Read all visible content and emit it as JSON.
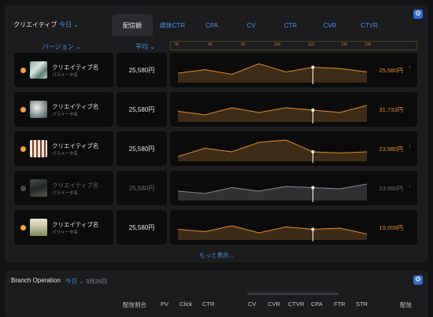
{
  "panel": {
    "title": "クリエイティブ",
    "scope": "今日 ⌄",
    "tabs": [
      "配信額",
      "媒体CTR",
      "CPA",
      "CV",
      "CTR",
      "CVR",
      "CTVR"
    ],
    "active_tab": 0,
    "version_header": "バージョン ⌄",
    "avg_header": "平均 ⌄",
    "scale_labels": [
      "78",
      "43",
      "90",
      "100",
      "110",
      "130",
      "130"
    ],
    "more_label": "もっと表示..."
  },
  "rows": [
    {
      "name": "クリエイティブ名",
      "param": "パラメータ名",
      "avg": "25,580円",
      "value": "25,580円",
      "arrow": "↑",
      "active": true,
      "series": [
        0.4,
        0.55,
        0.35,
        0.8,
        0.45,
        0.65,
        0.6,
        0.45
      ]
    },
    {
      "name": "クリエイティブ名",
      "param": "パラメータ名",
      "avg": "25,580円",
      "value": "31,733円",
      "arrow": "",
      "active": true,
      "series": [
        0.45,
        0.3,
        0.6,
        0.4,
        0.6,
        0.5,
        0.4,
        0.7
      ]
    },
    {
      "name": "クリエイティブ名",
      "param": "パラメータ名",
      "avg": "25,580円",
      "value": "23,980円",
      "arrow": "↑",
      "active": true,
      "series": [
        0.2,
        0.55,
        0.4,
        0.8,
        0.9,
        0.4,
        0.35,
        0.4
      ]
    },
    {
      "name": "クリエイティブ名",
      "param": "パラメータ名",
      "avg": "25,580円",
      "value": "23,980円",
      "arrow": "↓",
      "active": false,
      "series": [
        0.4,
        0.3,
        0.55,
        0.4,
        0.6,
        0.55,
        0.5,
        0.7
      ]
    },
    {
      "name": "クリエイティブ名",
      "param": "パラメータ名",
      "avg": "25,580円",
      "value": "19,008円",
      "arrow": "",
      "active": true,
      "series": [
        0.45,
        0.35,
        0.6,
        0.3,
        0.55,
        0.45,
        0.5,
        0.25
      ]
    }
  ],
  "branch": {
    "title": "Branch Operation",
    "scope": "今日 ⌄",
    "date": "3月26日",
    "columns": [
      "配信割合",
      "PV",
      "Click",
      "CTR",
      "CV",
      "CVR",
      "CTVR",
      "CPA",
      "FTR",
      "STR",
      "配信"
    ]
  },
  "colors": {
    "accent": "#e58a2a",
    "link": "#4a90e2",
    "panel": "#1c1c1f"
  }
}
